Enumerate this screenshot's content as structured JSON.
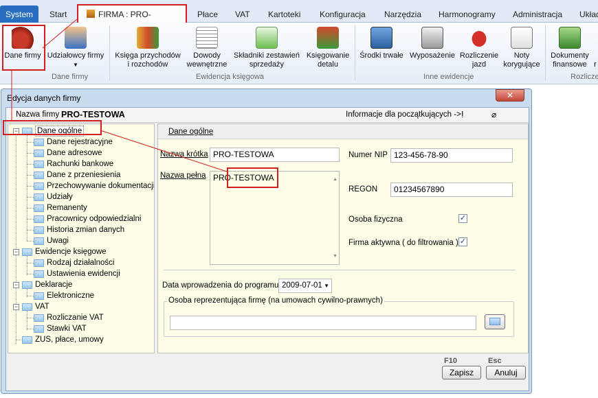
{
  "tabs": {
    "system": "System",
    "start": "Start",
    "firma": "FIRMA : PRO-TESTOWA",
    "place": "Płace",
    "vat": "VAT",
    "kartoteki": "Kartoteki",
    "konfiguracja": "Konfiguracja",
    "narzedzia": "Narzędzia",
    "harmonogramy": "Harmonogramy",
    "administracja": "Administracja",
    "uklad": "Układ"
  },
  "ribbon": {
    "dane_firmy": "Dane firmy",
    "udzialowcy": "Udziałowcy firmy",
    "ksiega": "Księga przychodów\ni rozchodów",
    "dowody": "Dowody\nwewnętrzne",
    "skladniki": "Składniki zestawień\nsprzedaży",
    "ksiegowanie": "Księgowanie\ndetalu",
    "srodki": "Środki trwałe",
    "wyposazenie": "Wyposażenie",
    "rozliczenie": "Rozliczenie\njazd",
    "noty": "Noty\nkorygujące",
    "dokumenty": "Dokumenty\nfinansowe",
    "last_partial": "r",
    "group_dane_firmy": "Dane firmy",
    "group_ewidencja": "Ewidencja księgowa",
    "group_inne": "Inne ewidencje",
    "group_rozlicze": "Rozlicze"
  },
  "dialog": {
    "title": "Edycja danych firmy",
    "close": "✕",
    "nazwa_firmy_label": "Nazwa firmy",
    "nazwa_firmy_value": "PRO-TESTOWA",
    "info_link": "Informacje dla początkujących ->"
  },
  "tree": [
    {
      "label": "Dane ogólne"
    },
    {
      "label": "Dane rejestracyjne"
    },
    {
      "label": "Dane adresowe"
    },
    {
      "label": "Rachunki bankowe"
    },
    {
      "label": "Dane z przeniesienia"
    },
    {
      "label": "Przechowywanie dokumentacji"
    },
    {
      "label": "Udziały"
    },
    {
      "label": "Remanenty"
    },
    {
      "label": "Pracownicy odpowiedzialni"
    },
    {
      "label": "Historia zmian danych"
    },
    {
      "label": "Uwagi"
    },
    {
      "label": "Ewidencje księgowe"
    },
    {
      "label": "Rodzaj działalności"
    },
    {
      "label": "Ustawienia ewidencji"
    },
    {
      "label": "Deklaracje"
    },
    {
      "label": "Elektroniczne"
    },
    {
      "label": "VAT"
    },
    {
      "label": "Rozliczanie VAT"
    },
    {
      "label": "Stawki VAT"
    },
    {
      "label": "ZUS, płace, umowy"
    }
  ],
  "form": {
    "tab": "Dane ogólne",
    "nazwa_krotka_label": "Nazwa krótka",
    "nazwa_krotka_value": "PRO-TESTOWA",
    "nazwa_pelna_label": "Nazwa pełna",
    "nazwa_pelna_value": "PRO-TESTOWA",
    "nip_label": "Numer NIP",
    "nip_value": "123-456-78-90",
    "regon_label": "REGON",
    "regon_value": "01234567890",
    "osoba_fizyczna_label": "Osoba fizyczna",
    "firma_aktywna_label": "Firma aktywna ( do filtrowania )",
    "data_label": "Data wprowadzenia do programu",
    "data_value": "2009-07-01",
    "osoba_rep_label": "Osoba reprezentująca firmę (na umowach cywilno-prawnych)",
    "osoba_rep_value": ""
  },
  "buttons": {
    "zapisz_key": "F10",
    "zapisz": "Zapisz",
    "anuluj_key": "Esc",
    "anuluj": "Anuluj"
  },
  "colors": {
    "accent_red": "#d11f1f",
    "system_tab": "#2a6fbf",
    "tree_bg": "#fdfde8"
  }
}
